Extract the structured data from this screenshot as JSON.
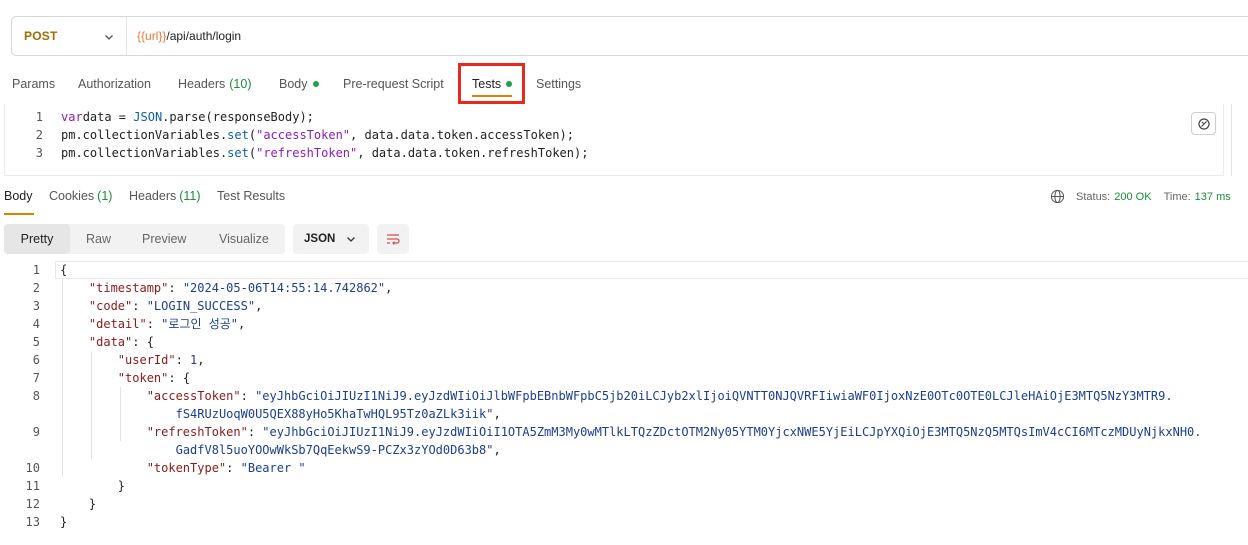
{
  "request": {
    "method": "POST",
    "url_var": "{{url}}",
    "url_path": "/api/auth/login"
  },
  "request_tabs": {
    "params": "Params",
    "authorization": "Authorization",
    "headers": "Headers",
    "headers_count": "(10)",
    "body": "Body",
    "prerequest": "Pre-request Script",
    "tests": "Tests",
    "settings": "Settings"
  },
  "script": {
    "lines": [
      {
        "num": "1",
        "parts": [
          [
            "kw",
            "var"
          ],
          [
            "",
            "data = "
          ],
          [
            "obj",
            "JSON"
          ],
          [
            "",
            ".parse(responseBody);"
          ]
        ]
      },
      {
        "num": "2",
        "parts": [
          [
            "",
            "pm.collectionVariables."
          ],
          [
            "obj",
            "set"
          ],
          [
            "",
            "("
          ],
          [
            "str",
            "\"accessToken\""
          ],
          [
            "",
            ", data.data.token.accessToken);"
          ]
        ]
      },
      {
        "num": "3",
        "parts": [
          [
            "",
            "pm.collectionVariables."
          ],
          [
            "obj",
            "set"
          ],
          [
            "",
            "("
          ],
          [
            "str",
            "\"refreshToken\""
          ],
          [
            "",
            ", data.data.token.refreshToken);"
          ]
        ]
      }
    ]
  },
  "response_tabs": {
    "body": "Body",
    "cookies": "Cookies",
    "cookies_count": "(1)",
    "headers": "Headers",
    "headers_count": "(11)",
    "test_results": "Test Results"
  },
  "status": {
    "status_label": "Status:",
    "status_value": "200 OK",
    "time_label": "Time:",
    "time_value": "137 ms"
  },
  "viewer": {
    "pretty": "Pretty",
    "raw": "Raw",
    "preview": "Preview",
    "visualize": "Visualize",
    "format": "JSON"
  },
  "response_json": {
    "lines": [
      {
        "num": "1",
        "indent": 0,
        "parts": [
          [
            "",
            "{"
          ]
        ]
      },
      {
        "num": "2",
        "indent": 1,
        "parts": [
          [
            "jk",
            "\"timestamp\""
          ],
          [
            "",
            ": "
          ],
          [
            "jv",
            "\"2024-05-06T14:55:14.742862\""
          ],
          [
            "",
            ","
          ]
        ]
      },
      {
        "num": "3",
        "indent": 1,
        "parts": [
          [
            "jk",
            "\"code\""
          ],
          [
            "",
            ": "
          ],
          [
            "jv",
            "\"LOGIN_SUCCESS\""
          ],
          [
            "",
            ","
          ]
        ]
      },
      {
        "num": "4",
        "indent": 1,
        "parts": [
          [
            "jk",
            "\"detail\""
          ],
          [
            "",
            ": "
          ],
          [
            "jv",
            "\"로그인 성공\""
          ],
          [
            "",
            ","
          ]
        ]
      },
      {
        "num": "5",
        "indent": 1,
        "parts": [
          [
            "jk",
            "\"data\""
          ],
          [
            "",
            ": {"
          ]
        ]
      },
      {
        "num": "6",
        "indent": 2,
        "parts": [
          [
            "jk",
            "\"userId\""
          ],
          [
            "",
            ": "
          ],
          [
            "jn",
            "1"
          ],
          [
            "",
            ","
          ]
        ]
      },
      {
        "num": "7",
        "indent": 2,
        "parts": [
          [
            "jk",
            "\"token\""
          ],
          [
            "",
            ": {"
          ]
        ]
      },
      {
        "num": "8",
        "indent": 3,
        "parts": [
          [
            "jk",
            "\"accessToken\""
          ],
          [
            "",
            ": "
          ],
          [
            "jv",
            "\"eyJhbGciOiJIUzI1NiJ9.eyJzdWIiOiJlbWFpbEBnbWFpbC5jb20iLCJyb2xlIjoiQVNTT0NJQVRFIiwiaWF0IjoxNzE0OTc0OTE0LCJleHAiOjE3MTQ5NzY3MTR9."
          ]
        ]
      },
      {
        "num": "",
        "indent": 4,
        "parts": [
          [
            "jv",
            "fS4RUzUoqW0U5QEX88yHo5KhaTwHQL95Tz0aZLk3iik\""
          ],
          [
            "",
            ","
          ]
        ]
      },
      {
        "num": "9",
        "indent": 3,
        "parts": [
          [
            "jk",
            "\"refreshToken\""
          ],
          [
            "",
            ": "
          ],
          [
            "jv",
            "\"eyJhbGciOiJIUzI1NiJ9.eyJzdWIiOiI1OTA5ZmM3My0wMTlkLTQzZDctOTM2Ny05YTM0YjcxNWE5YjEiLCJpYXQiOjE3MTQ5NzQ5MTQsImV4cCI6MTczMDUyNjkxNH0."
          ]
        ]
      },
      {
        "num": "",
        "indent": 4,
        "parts": [
          [
            "jv",
            "GadfV8l5uoYOOwWkSb7QqEekwS9-PCZx3zYOd0D63b8\""
          ],
          [
            "",
            ","
          ]
        ]
      },
      {
        "num": "10",
        "indent": 3,
        "parts": [
          [
            "jk",
            "\"tokenType\""
          ],
          [
            "",
            ": "
          ],
          [
            "jv",
            "\"Bearer \""
          ]
        ]
      },
      {
        "num": "11",
        "indent": 2,
        "parts": [
          [
            "",
            "}"
          ]
        ]
      },
      {
        "num": "12",
        "indent": 1,
        "parts": [
          [
            "",
            "}"
          ]
        ]
      },
      {
        "num": "13",
        "indent": 0,
        "parts": [
          [
            "",
            "}"
          ]
        ]
      }
    ]
  },
  "icons": {
    "method_dropdown": "chevron-down-icon",
    "snippets": "snippet-icon",
    "globe": "globe-icon",
    "format_dropdown": "chevron-down-icon",
    "wrap": "wrap-lines-icon"
  },
  "colors": {
    "method": "#a56a00",
    "url_variable": "#e87b33",
    "active_underline": "#e07f00",
    "highlight": "#e8291c",
    "status_ok": "#1a8d3b",
    "dot": "#1aa34a"
  }
}
